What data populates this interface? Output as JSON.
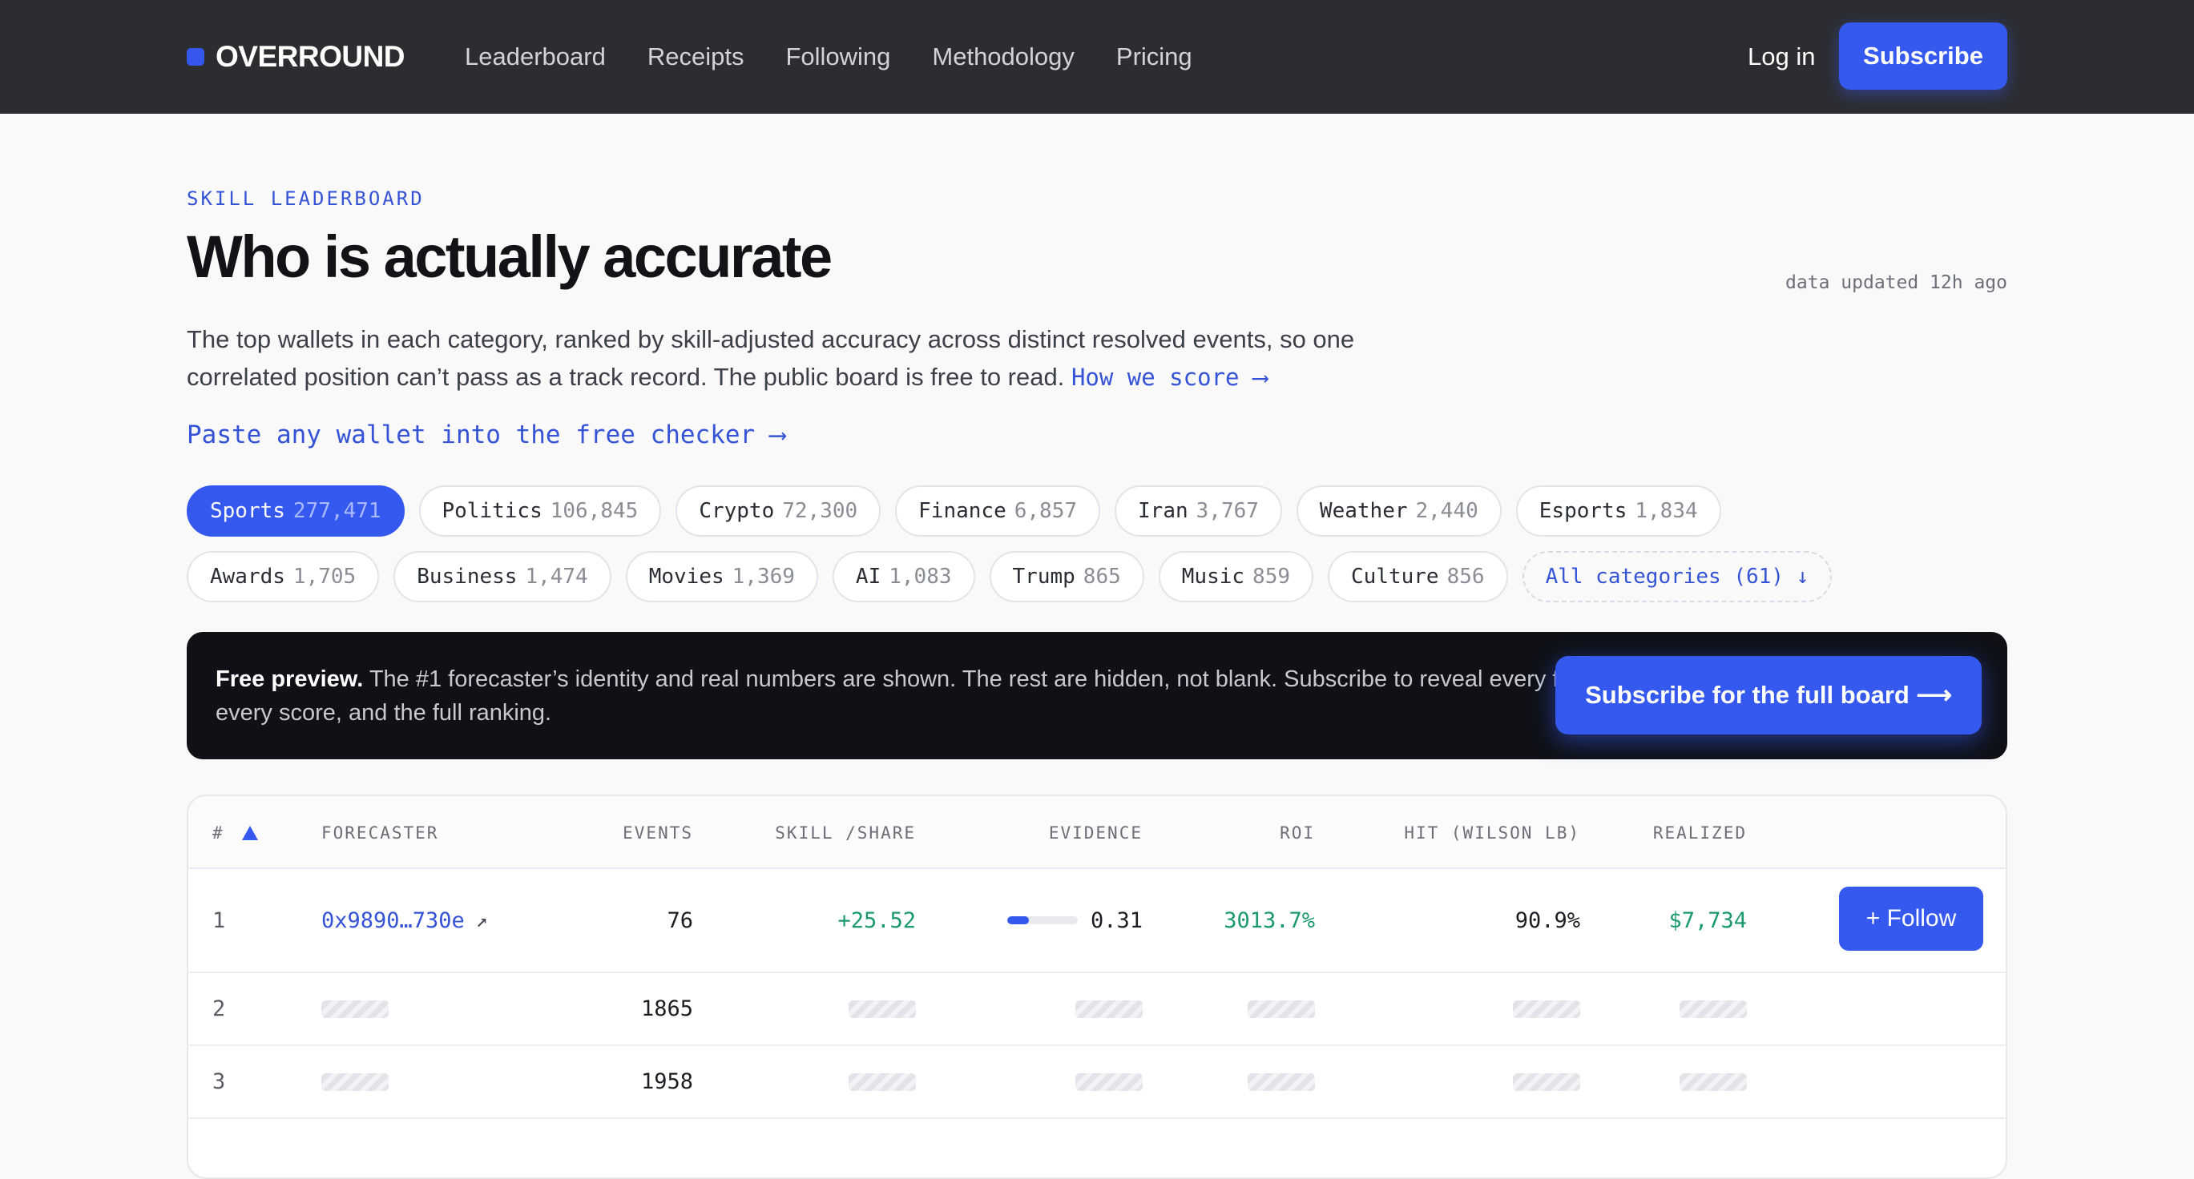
{
  "nav": {
    "brand": "OVERROUND",
    "links": [
      "Leaderboard",
      "Receipts",
      "Following",
      "Methodology",
      "Pricing"
    ],
    "login": "Log in",
    "subscribe": "Subscribe"
  },
  "header": {
    "eyebrow": "SKILL LEADERBOARD",
    "title": "Who is actually accurate",
    "updated": "data updated 12h ago",
    "intro": "The top wallets in each category, ranked by skill-adjusted accuracy across distinct resolved events, so one correlated position can’t pass as a track record. The public board is free to read.",
    "score_link": "How we score ⟶",
    "checker_link": "Paste any wallet into the free checker ⟶"
  },
  "chips": [
    {
      "name": "Sports",
      "count": "277,471"
    },
    {
      "name": "Politics",
      "count": "106,845"
    },
    {
      "name": "Crypto",
      "count": "72,300"
    },
    {
      "name": "Finance",
      "count": "6,857"
    },
    {
      "name": "Iran",
      "count": "3,767"
    },
    {
      "name": "Weather",
      "count": "2,440"
    },
    {
      "name": "Esports",
      "count": "1,834"
    },
    {
      "name": "Awards",
      "count": "1,705"
    },
    {
      "name": "Business",
      "count": "1,474"
    },
    {
      "name": "Movies",
      "count": "1,369"
    },
    {
      "name": "AI",
      "count": "1,083"
    },
    {
      "name": "Trump",
      "count": "865"
    },
    {
      "name": "Music",
      "count": "859"
    },
    {
      "name": "Culture",
      "count": "856"
    }
  ],
  "all_categories": "All categories (61) ↓",
  "banner": {
    "bold": "Free preview.",
    "text": "The #1 forecaster’s identity and real numbers are shown. The rest are hidden, not blank. Subscribe to reveal every forecaster, every score, and the full ranking.",
    "button": "Subscribe for the full board ⟶"
  },
  "table": {
    "headers": {
      "rank": "#",
      "forecaster": "FORECASTER",
      "events": "EVENTS",
      "skill": "SKILL /SHARE",
      "evidence": "EVIDENCE",
      "roi": "ROI",
      "hit": "HIT (WILSON LB)",
      "realized": "REALIZED"
    },
    "top_row": {
      "rank": "1",
      "forecaster": "0x9890…730e",
      "ext_icon": "↗",
      "events": "76",
      "skill": "+25.52",
      "evidence": "0.31",
      "evidence_fraction": 0.31,
      "roi": "3013.7%",
      "hit": "90.9%",
      "realized": "$7,734",
      "follow": "+ Follow"
    },
    "hidden_rows": [
      {
        "rank": "2",
        "events": "1865"
      },
      {
        "rank": "3",
        "events": "1958"
      }
    ]
  },
  "colors": {
    "accent": "#3558ef",
    "nav_bg": "#2c2d31",
    "positive": "#1a9a6c",
    "banner_bg": "#0f1116"
  }
}
